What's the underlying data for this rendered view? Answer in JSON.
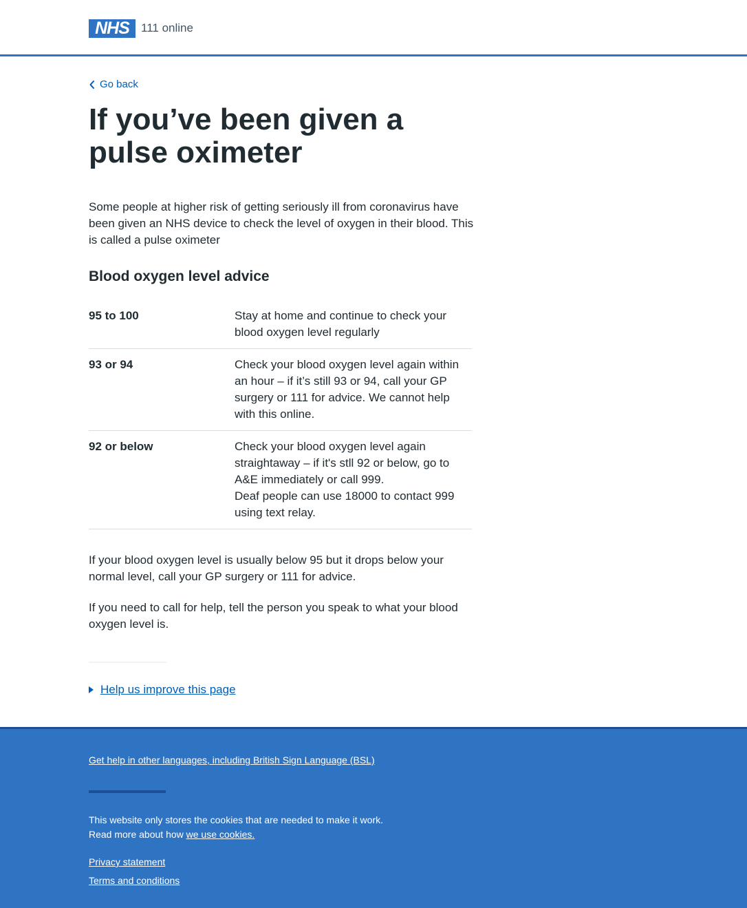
{
  "header": {
    "logo_text": "NHS",
    "service_name": "111 online",
    "logo_color": "#2f73c3"
  },
  "nav": {
    "back_label": "Go back",
    "back_icon": "chevron-left-icon"
  },
  "main": {
    "title": "If you’ve been given a pulse oximeter",
    "intro": "Some people at higher risk of getting seriously ill from coronavirus have been given an NHS device to check the level of oxygen in their blood. This is called a pulse oximeter",
    "section_heading": "Blood oxygen level advice",
    "advice_rows": [
      {
        "level": "95 to 100",
        "advice": [
          "Stay at home and continue to check your blood oxygen level regularly"
        ]
      },
      {
        "level": "93 or 94",
        "advice": [
          "Check your blood oxygen level again within an hour – if it’s still 93 or 94, call your GP surgery or 111 for advice. We cannot help with this online."
        ]
      },
      {
        "level": "92 or below",
        "advice": [
          "Check your blood oxygen level again straightaway – if it's stll 92 or below, go to A&E immediately or call 999.",
          "Deaf people can use 18000 to contact 999 using text relay."
        ]
      }
    ],
    "para1": "If your blood oxygen level is usually below 95 but it drops below your normal level, call your GP surgery or 111 for advice.",
    "para2": "If you need to call for help, tell the person you speak to what your blood oxygen level is.",
    "feedback_label": " Help us improve this page"
  },
  "footer": {
    "languages_link": "Get help in other languages, including British Sign Language (BSL)",
    "cookie_line1": "This website only stores the cookies that are needed to make it work.",
    "cookie_line2_prefix": "Read more about how ",
    "cookie_link": "we use cookies.",
    "privacy_link": "Privacy statement",
    "terms_link": "Terms and conditions",
    "background_color": "#2f73c3"
  }
}
